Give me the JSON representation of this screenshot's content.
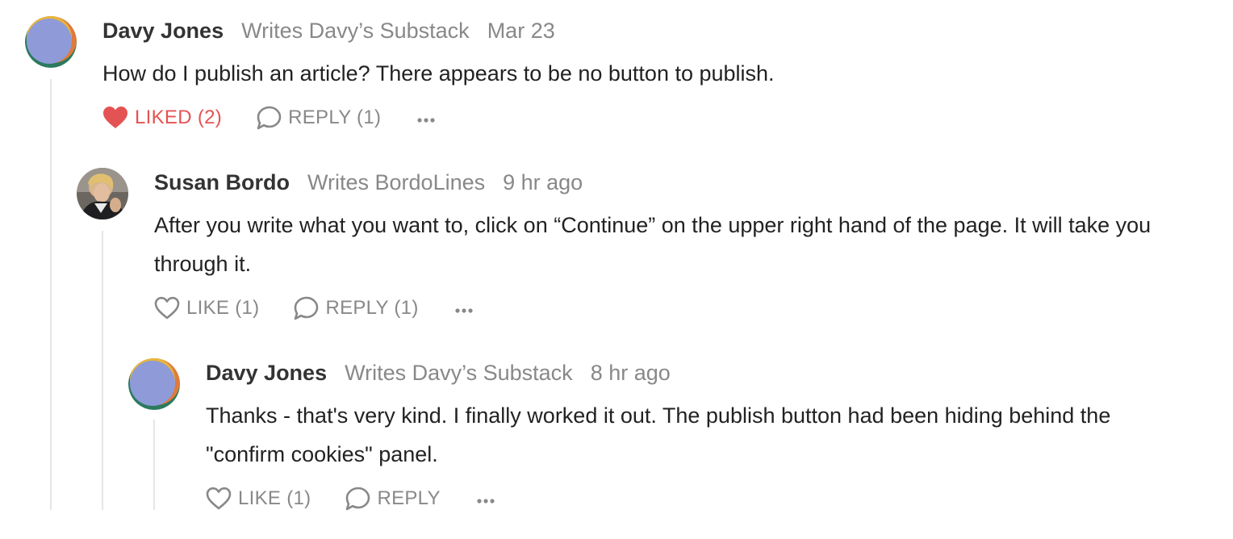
{
  "comments": [
    {
      "author": "Davy Jones",
      "publication": "Writes Davy’s Substack",
      "date": "Mar 23",
      "body": "How do I publish an article? There appears to be no button to publish.",
      "like_label": "LIKED (2)",
      "like_state": "liked",
      "reply_label": "REPLY (1)",
      "more_icon": "ellipsis-icon"
    },
    {
      "author": "Susan Bordo",
      "publication": "Writes BordoLines",
      "date": "9 hr ago",
      "body": "After you write what you want to, click on “Continue” on the upper right hand of the page. It will take you through it.",
      "like_label": "LIKE (1)",
      "like_state": "not-liked",
      "reply_label": "REPLY (1)",
      "more_icon": "ellipsis-icon"
    },
    {
      "author": "Davy Jones",
      "publication": "Writes Davy’s Substack",
      "date": "8 hr ago",
      "body": "Thanks - that's very kind. I finally worked it out. The publish button had been hiding behind the \"confirm cookies\" panel.",
      "like_label": "LIKE (1)",
      "like_state": "not-liked",
      "reply_label": "REPLY",
      "more_icon": "ellipsis-icon"
    }
  ],
  "colors": {
    "liked": "#e45353",
    "muted": "#888888",
    "text": "#222222",
    "thread_line": "#e6e6e6",
    "avatar_periwinkle": "#8e9bd8",
    "avatar_green": "#2b7a5e",
    "avatar_orange": "#e07a3a",
    "avatar_yellow": "#e9b53b"
  },
  "icons": {
    "liked": "heart-filled-icon",
    "like": "heart-outline-icon",
    "reply": "speech-bubble-icon",
    "more": "ellipsis-icon"
  }
}
